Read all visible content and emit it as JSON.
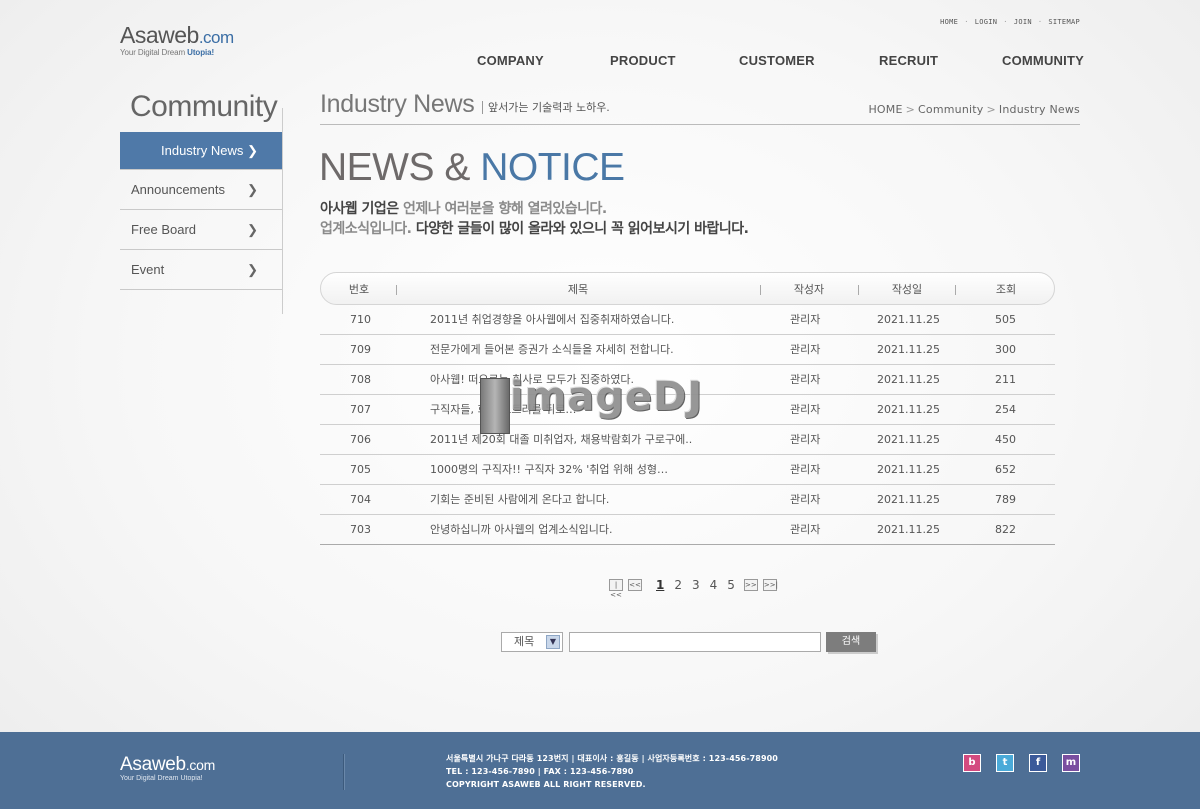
{
  "brand": {
    "name": "Asaweb",
    "domain": ".com",
    "tagline_prefix": "Your Digital Dream ",
    "tagline_highlight": "Utopia!"
  },
  "util_nav": [
    "HOME",
    "LOGIN",
    "JOIN",
    "SITEMAP"
  ],
  "gnb": [
    "COMPANY",
    "PRODUCT",
    "CUSTOMER",
    "RECRUIT",
    "COMMUNITY"
  ],
  "sidebar": {
    "title": "Community",
    "items": [
      {
        "label": "Industry News",
        "active": true
      },
      {
        "label": "Announcements",
        "active": false
      },
      {
        "label": "Free Board",
        "active": false
      },
      {
        "label": "Event",
        "active": false
      }
    ]
  },
  "content": {
    "title": "Industry News",
    "subtitle": "앞서가는 기술력과 노하우.",
    "breadcrumb": [
      "HOME",
      "Community",
      "Industry News"
    ],
    "hero_a": "NEWS & ",
    "hero_b": "NOTICE",
    "lead1_dark": "아사웹 기업은 ",
    "lead1_light": "언제나 여러분을 향해 열려있습니다.",
    "lead2_light": "업계소식입니다. ",
    "lead2_dark": "다양한 글들이 많이 올라와 있으니 꼭 읽어보시기 바랍니다."
  },
  "board": {
    "headers": [
      "번호",
      "제목",
      "작성자",
      "작성일",
      "조회"
    ],
    "rows": [
      {
        "no": "710",
        "title": "2011년 취업경향을 아사웹에서 집중취재하였습니다.",
        "author": "관리자",
        "date": "2021.11.25",
        "views": "505"
      },
      {
        "no": "709",
        "title": "전문가에게 들어본 증권가 소식들을 자세히 전합니다.",
        "author": "관리자",
        "date": "2021.11.25",
        "views": "300"
      },
      {
        "no": "708",
        "title": "아사웹! 떠오르는 회사로 모두가 집중하였다.",
        "author": "관리자",
        "date": "2021.11.25",
        "views": "211"
      },
      {
        "no": "707",
        "title": "구직자들, 희망 노트리를 뒤로…",
        "author": "관리자",
        "date": "2021.11.25",
        "views": "254"
      },
      {
        "no": "706",
        "title": "2011년 제20회 대졸 미취업자, 채용박람회가 구로구에..",
        "author": "관리자",
        "date": "2021.11.25",
        "views": "450"
      },
      {
        "no": "705",
        "title": "1000명의 구직자!! 구직자 32% '취업 위해 성형…",
        "author": "관리자",
        "date": "2021.11.25",
        "views": "652"
      },
      {
        "no": "704",
        "title": "기회는 준비된 사람에게 온다고 합니다.",
        "author": "관리자",
        "date": "2021.11.25",
        "views": "789"
      },
      {
        "no": "703",
        "title": "안녕하십니까 아사웹의 업계소식입니다.",
        "author": "관리자",
        "date": "2021.11.25",
        "views": "822"
      }
    ]
  },
  "paging": {
    "first": "|<<",
    "prev": "<<",
    "pages": [
      "1",
      "2",
      "3",
      "4",
      "5"
    ],
    "current": "1",
    "next": ">>",
    "last": ">>|"
  },
  "search": {
    "field_selected": "제목",
    "input_value": "",
    "button_label": "검색"
  },
  "watermark": "imageDJ",
  "footer": {
    "address": "서울특별시 가나구 다라동 123번지  |  대표이사 : 홍길동  |  사업자등록번호 : 123-456-78900",
    "contact": "TEL : 123-456-7890  |  FAX : 123-456-7890",
    "copyright": "COPYRIGHT ASAWEB ALL RIGHT RESERVED.",
    "sns": [
      {
        "name": "blog-icon",
        "glyph": "b"
      },
      {
        "name": "twitter-icon",
        "glyph": "t"
      },
      {
        "name": "facebook-icon",
        "glyph": "f"
      },
      {
        "name": "messenger-icon",
        "glyph": "m"
      }
    ]
  },
  "colors": {
    "accent": "#4f79a8",
    "footer_bg": "#4e6f95",
    "hero_gray": "#6e6a6a",
    "hero_blue": "#4a78a6"
  }
}
